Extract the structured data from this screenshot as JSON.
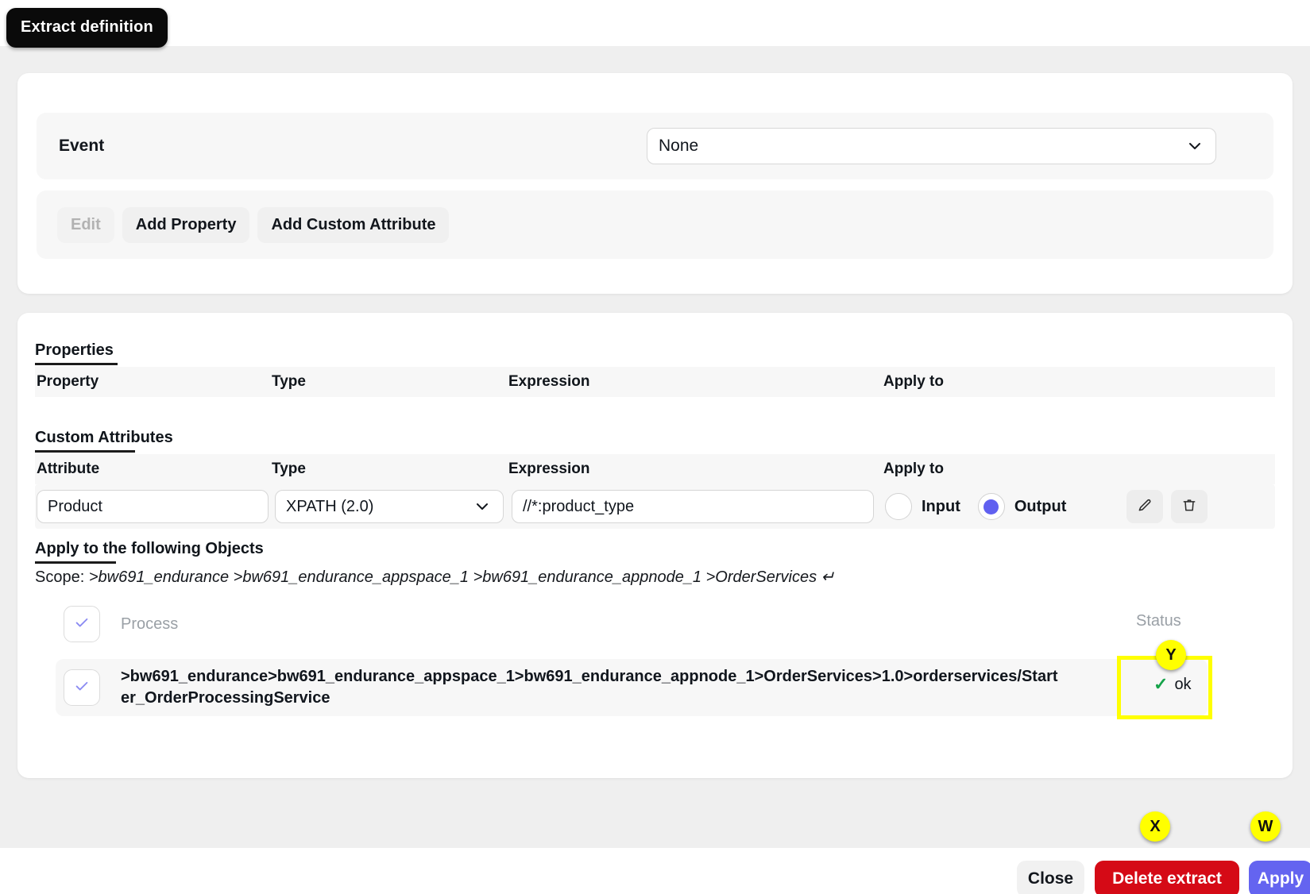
{
  "tooltip": {
    "label": "Extract definition"
  },
  "event_section": {
    "label": "Event",
    "select_value": "None",
    "caret_icon": "chevron-down-icon"
  },
  "toolbar": {
    "edit_label": "Edit",
    "add_property_label": "Add Property",
    "add_custom_attribute_label": "Add Custom Attribute"
  },
  "properties": {
    "title": "Properties",
    "columns": [
      "Property",
      "Type",
      "Expression",
      "Apply to"
    ],
    "rows": []
  },
  "custom_attributes": {
    "title": "Custom Attributes",
    "columns": [
      "Attribute",
      "Type",
      "Expression",
      "Apply to"
    ],
    "row": {
      "attribute": "Product",
      "type": "XPATH (2.0)",
      "type_caret_icon": "chevron-down-icon",
      "expression": "//*:product_type",
      "apply_input_label": "Input",
      "apply_output_label": "Output",
      "apply_selected": "Output",
      "edit_icon": "pencil-icon",
      "delete_icon": "trash-icon"
    }
  },
  "apply_to_objects": {
    "title": "Apply to the following Objects",
    "scope_label": "Scope: ",
    "scope_path": ">bw691_endurance >bw691_endurance_appspace_1 >bw691_endurance_appnode_1 >OrderServices ",
    "scope_wrap_icon": "↵",
    "header_row": {
      "checkbox_icon": "check-icon",
      "label": "Process",
      "status_label": "Status"
    },
    "rows": [
      {
        "checkbox_icon": "check-icon",
        "path": ">bw691_endurance>bw691_endurance_appspace_1>bw691_endurance_appnode_1>OrderServices>1.0>orderservices/Starter_OrderProcessingService",
        "status": "ok",
        "status_icon": "check-icon"
      }
    ]
  },
  "footer": {
    "close_label": "Close",
    "delete_label": "Delete extract",
    "apply_label": "Apply"
  },
  "markers": [
    {
      "id": "Y",
      "target": "status-column"
    },
    {
      "id": "X",
      "target": "delete-extract-button"
    },
    {
      "id": "W",
      "target": "apply-button"
    }
  ],
  "colors": {
    "accent": "#6464f0",
    "danger": "#d50a16",
    "success": "#16a34a",
    "highlight": "#ffff00",
    "backdrop": "#efefef"
  }
}
